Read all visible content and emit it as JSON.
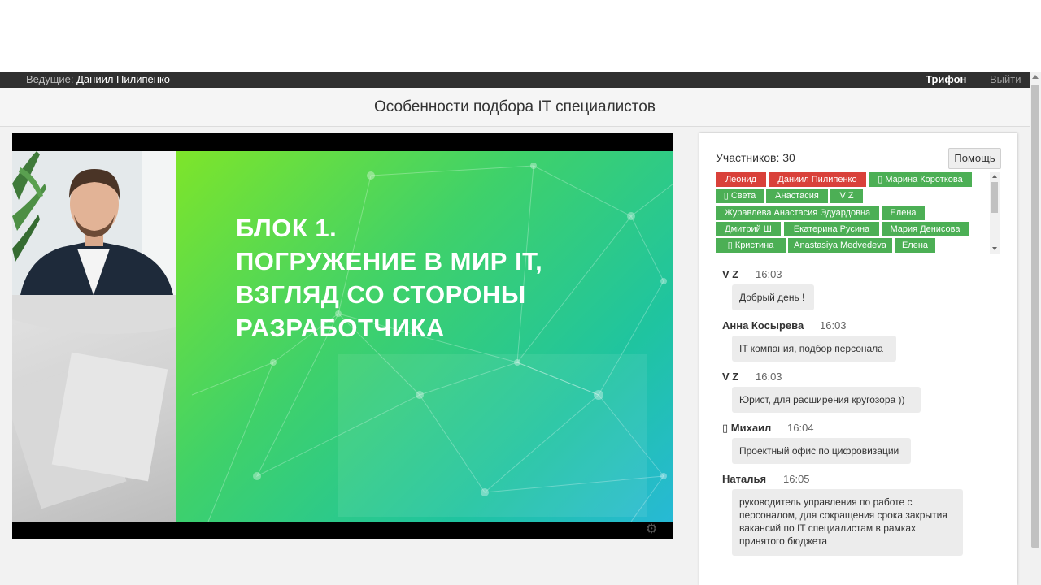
{
  "topbar": {
    "host_label": "Ведущие:",
    "host_name": "Даниил Пилипенко",
    "user": "Трифон",
    "logout": "Выйти"
  },
  "title": "Особенности подбора IT специалистов",
  "slide": {
    "lines": [
      "БЛОК 1.",
      "ПОГРУЖЕНИЕ В МИР IT,",
      "ВЗГЛЯД СО СТОРОНЫ",
      "РАЗРАБОТЧИКА"
    ]
  },
  "panel": {
    "participants_label": "Участников: 30",
    "help_button": "Помощь",
    "participants": [
      {
        "name": "Леонид",
        "color": "red"
      },
      {
        "name": "Даниил Пилипенко",
        "color": "red"
      },
      {
        "name": "▯ Марина Короткова",
        "color": "green"
      },
      {
        "name": "▯ Света",
        "color": "green"
      },
      {
        "name": "Анастасия",
        "color": "green"
      },
      {
        "name": "V Z",
        "color": "green"
      },
      {
        "name": "Журавлева Анастасия Эдуардовна",
        "color": "green"
      },
      {
        "name": "Елена",
        "color": "green"
      },
      {
        "name": "Дмитрий Ш",
        "color": "green"
      },
      {
        "name": "Екатерина Русина",
        "color": "green"
      },
      {
        "name": "Мария Денисова",
        "color": "green"
      },
      {
        "name": "▯ Кристина",
        "color": "green"
      },
      {
        "name": "Anastasiya Medvedeva",
        "color": "green"
      },
      {
        "name": "Елена",
        "color": "green"
      }
    ],
    "messages": [
      {
        "author": "V Z",
        "time": "16:03",
        "text": "Добрый день !"
      },
      {
        "author": "Анна Косырева",
        "time": "16:03",
        "text": "IT компания, подбор персонала"
      },
      {
        "author": "V Z",
        "time": "16:03",
        "text": "Юрист, для расширения кругозора ))"
      },
      {
        "author": "▯ Михаил",
        "time": "16:04",
        "text": "Проектный офис по цифровизации"
      },
      {
        "author": "Наталья",
        "time": "16:05",
        "text": "руководитель управления по работе с персоналом, для сокращения срока закрытия вакансий по IT специалистам в рамках принятого бюджета"
      }
    ]
  },
  "colors": {
    "chip_red": "#d9413a",
    "chip_green": "#4caf55",
    "topbar_bg": "#303030"
  },
  "icons": {
    "settings": "gear-icon",
    "participant_mic": "mic-icon"
  }
}
